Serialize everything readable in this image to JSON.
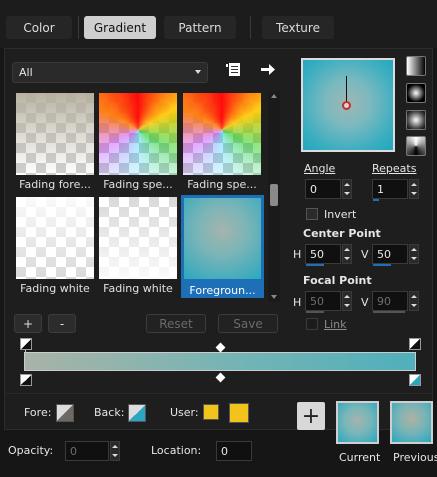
{
  "tabs": [
    {
      "label": "Color"
    },
    {
      "label": "Gradient"
    },
    {
      "label": "Pattern"
    },
    {
      "label": "Texture"
    }
  ],
  "active_tab": "Gradient",
  "category": {
    "selected": "All"
  },
  "gradients": [
    {
      "label": "Fading fore..."
    },
    {
      "label": "Fading spe..."
    },
    {
      "label": "Fading spe..."
    },
    {
      "label": "Fading white"
    },
    {
      "label": "Fading white"
    },
    {
      "label": "Foregroun..."
    }
  ],
  "buttons": {
    "add": "+",
    "remove": "-",
    "reset": "Reset",
    "save": "Save"
  },
  "angle": {
    "label": "Angle",
    "value": "0"
  },
  "repeats": {
    "label": "Repeats",
    "value": "1"
  },
  "invert": {
    "label": "Invert",
    "checked": false
  },
  "center_point": {
    "label": "Center Point",
    "h_label": "H",
    "h_value": "50",
    "v_label": "V",
    "v_value": "50"
  },
  "focal_point": {
    "label": "Focal Point",
    "h_label": "H",
    "h_value": "50",
    "v_label": "V",
    "v_value": "90"
  },
  "link": {
    "label": "Link",
    "checked": false
  },
  "fore": {
    "label": "Fore:"
  },
  "back": {
    "label": "Back:"
  },
  "user": {
    "label": "User:"
  },
  "opacity": {
    "label": "Opacity:",
    "value": "0"
  },
  "location": {
    "label": "Location:",
    "value": "0"
  },
  "samples": {
    "current": "Current",
    "previous": "Previous"
  },
  "colors": {
    "accent": "#1d70b7",
    "gold": "#f2c31a",
    "teal": "#2aa6c0",
    "tan": "#b4ae9c"
  }
}
